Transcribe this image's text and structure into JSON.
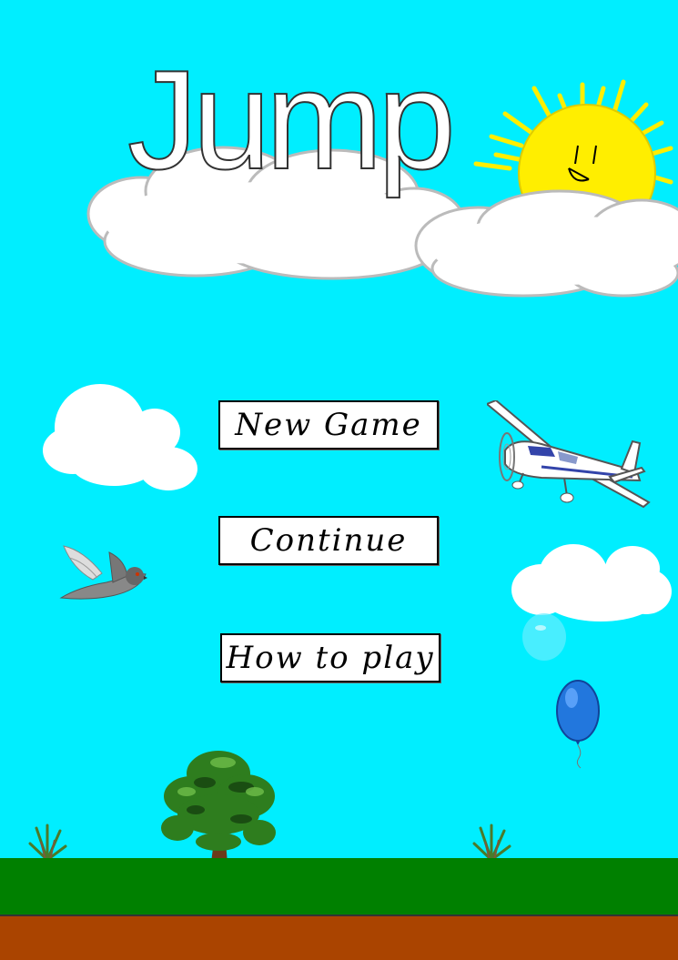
{
  "game": {
    "title": "Jump",
    "menu": {
      "new_game": "New Game",
      "continue": "Continue",
      "how_to_play": "How to play"
    }
  },
  "colors": {
    "sky": "#00eeff",
    "grass": "#008000",
    "dirt": "#aa4400",
    "sun": "#ffee00"
  },
  "icons": {
    "sun": "smiling-sun",
    "plane": "propeller-airplane",
    "bird": "pigeon",
    "balloon": "blue-balloon",
    "tree": "tree",
    "grass_tufts": "grass-tuft"
  }
}
